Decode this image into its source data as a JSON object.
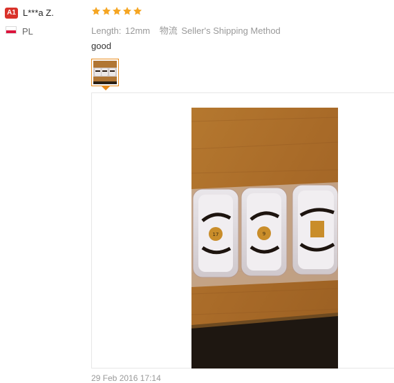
{
  "reviewer": {
    "level_badge": "A1",
    "name": "L***a Z.",
    "country": "PL",
    "flag_colors": [
      "#ffffff",
      "#dc143c"
    ]
  },
  "review": {
    "rating": 5,
    "star_color": "#f5a623",
    "length_label": "Length:",
    "length_value": "12mm",
    "shipping_label": "物流",
    "shipping_value": "Seller's Shipping Method",
    "comment": "good",
    "date": "29 Feb 2016 17:14"
  },
  "photos": [
    {
      "thumbnail_icon": "eyelash-packages-photo",
      "selected": true
    }
  ],
  "colors": {
    "accent": "#e88a1a",
    "badge": "#d9322a"
  }
}
